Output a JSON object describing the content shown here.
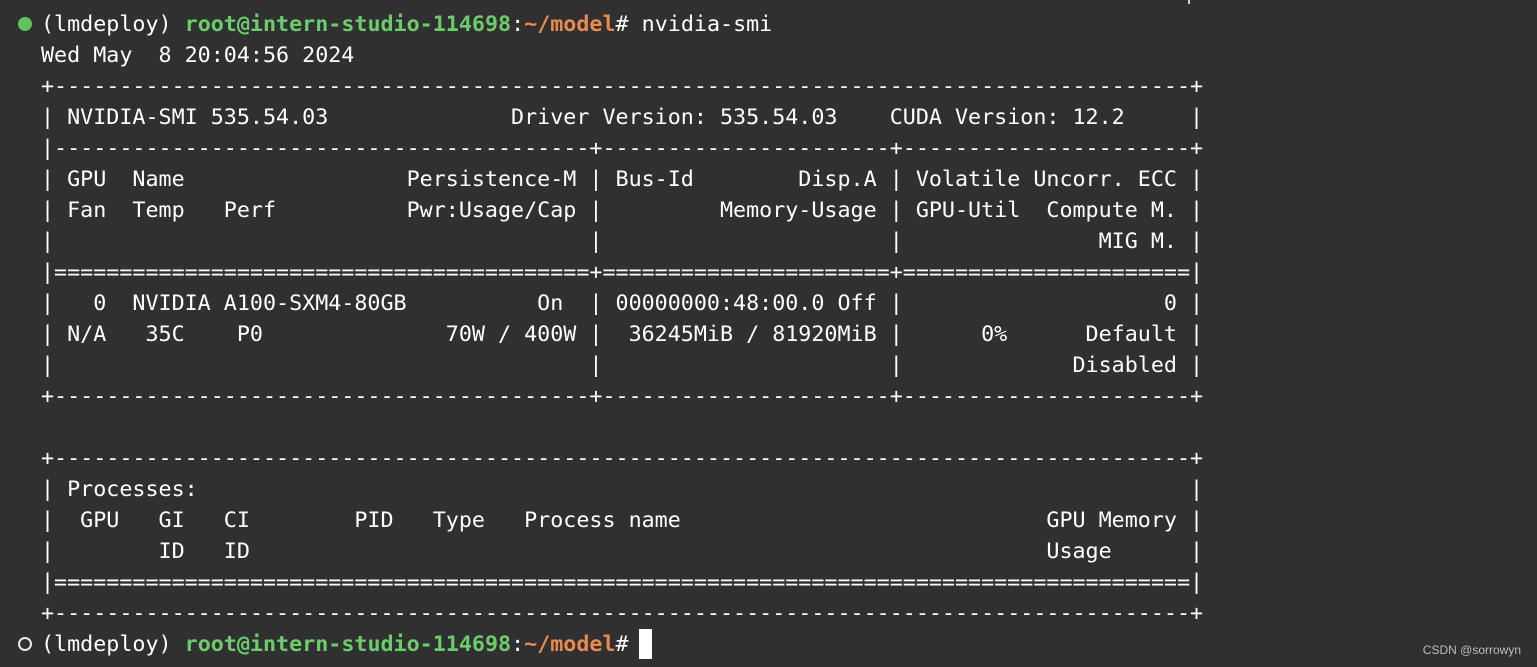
{
  "prompt": {
    "env": "(lmdeploy)",
    "user_host": "root@intern-studio-114698",
    "colon": ":",
    "path": "~/model",
    "symbol": "#",
    "command": " nvidia-smi"
  },
  "output": {
    "date_line": "Wed May  8 20:04:56 2024",
    "lines": [
      "+---------------------------------------------------------------------------------------+",
      "| NVIDIA-SMI 535.54.03              Driver Version: 535.54.03    CUDA Version: 12.2     |",
      "|-----------------------------------------+----------------------+----------------------+",
      "| GPU  Name                 Persistence-M | Bus-Id        Disp.A | Volatile Uncorr. ECC |",
      "| Fan  Temp   Perf          Pwr:Usage/Cap |         Memory-Usage | GPU-Util  Compute M. |",
      "|                                         |                      |               MIG M. |",
      "|=========================================+======================+======================|",
      "|   0  NVIDIA A100-SXM4-80GB          On  | 00000000:48:00.0 Off |                    0 |",
      "| N/A   35C    P0              70W / 400W |  36245MiB / 81920MiB |      0%      Default |",
      "|                                         |                      |             Disabled |",
      "+-----------------------------------------+----------------------+----------------------+",
      "",
      "+---------------------------------------------------------------------------------------+",
      "| Processes:                                                                            |",
      "|  GPU   GI   CI        PID   Type   Process name                            GPU Memory |",
      "|        ID   ID                                                             Usage      |",
      "|=======================================================================================|",
      "+---------------------------------------------------------------------------------------+"
    ]
  },
  "prompt2": {
    "env": "(lmdeploy)",
    "user_host": "root@intern-studio-114698",
    "colon": ":",
    "path": "~/model",
    "symbol": "# "
  },
  "watermark": "CSDN @sorrowyn",
  "colors": {
    "background": "#303031",
    "user_host": "#6ccc6c",
    "path": "#e68a4f",
    "text": "#ffffff"
  }
}
